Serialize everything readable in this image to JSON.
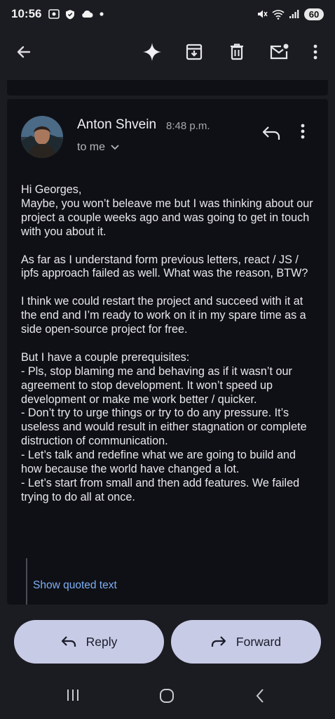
{
  "status": {
    "time": "10:56",
    "battery": "60"
  },
  "email": {
    "sender_name": "Anton Shvein",
    "time": "8:48 p.m.",
    "recipients": "to me",
    "paragraphs": [
      "Hi Georges,\nMaybe, you won’t beleave me but I was thinking about our project a couple weeks ago and was going to get in touch with you about it.",
      "As far as I understand form previous letters, react / JS / ipfs approach failed as well. What was the reason, BTW?",
      "I think we could restart the project and succeed with it at the end and I’m ready to work on it in my spare time as a side open-source project for free.",
      "But I have a couple prerequisites:\n- Pls, stop blaming me and behaving as if it wasn’t our agreement to stop development. It won’t speed up development or make me work better / quicker.\n- Don’t try to urge things or try to do any pressure. It’s useless and would result in either stagnation or complete distruction of communication.\n- Let’s talk and redefine what we are going to build and how because the world have changed a lot.\n- Let’s start from small and then add features. We failed trying to do all at once."
    ],
    "show_quoted": "Show quoted text"
  },
  "actions": {
    "reply_label": "Reply",
    "forward_label": "Forward"
  },
  "icons": {
    "back": "arrow-back-icon",
    "gemini": "sparkle-icon",
    "archive": "archive-icon",
    "delete": "trash-icon",
    "unread": "mark-unread-icon",
    "more": "more-vert-icon"
  },
  "colors": {
    "accent_link": "#7eb0f5",
    "button_bg": "#c8cbe6"
  }
}
